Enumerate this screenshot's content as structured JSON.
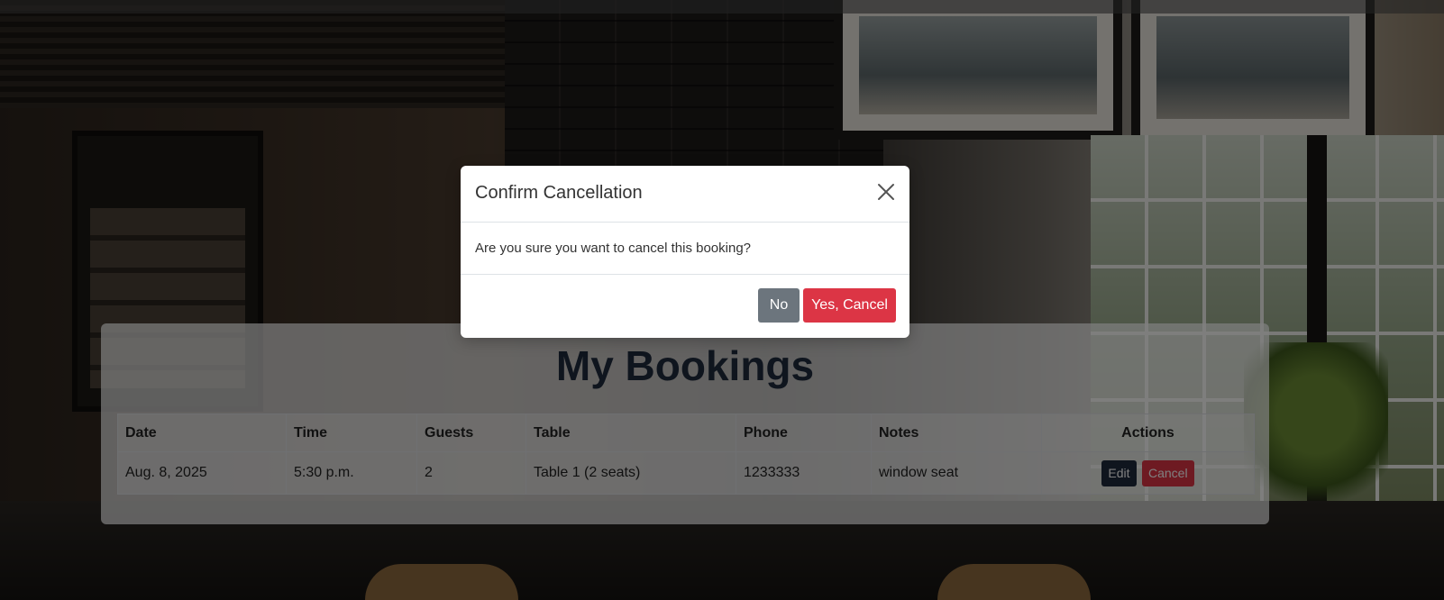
{
  "page": {
    "title": "My Bookings"
  },
  "bookings_table": {
    "headers": [
      "Date",
      "Time",
      "Guests",
      "Table",
      "Phone",
      "Notes",
      "Actions"
    ],
    "rows": [
      {
        "date": "Aug. 8, 2025",
        "time": "5:30 p.m.",
        "guests": "2",
        "table": "Table 1 (2 seats)",
        "phone": "1233333",
        "notes": "window seat",
        "edit_label": "Edit",
        "cancel_label": "Cancel"
      }
    ]
  },
  "modal": {
    "title": "Confirm Cancellation",
    "message": "Are you sure you want to cancel this booking?",
    "no_label": "No",
    "yes_label": "Yes, Cancel",
    "close_icon": "close-icon"
  },
  "colors": {
    "primary_dark": "#1f2a3d",
    "danger": "#dc3545",
    "secondary": "#6c757d"
  }
}
